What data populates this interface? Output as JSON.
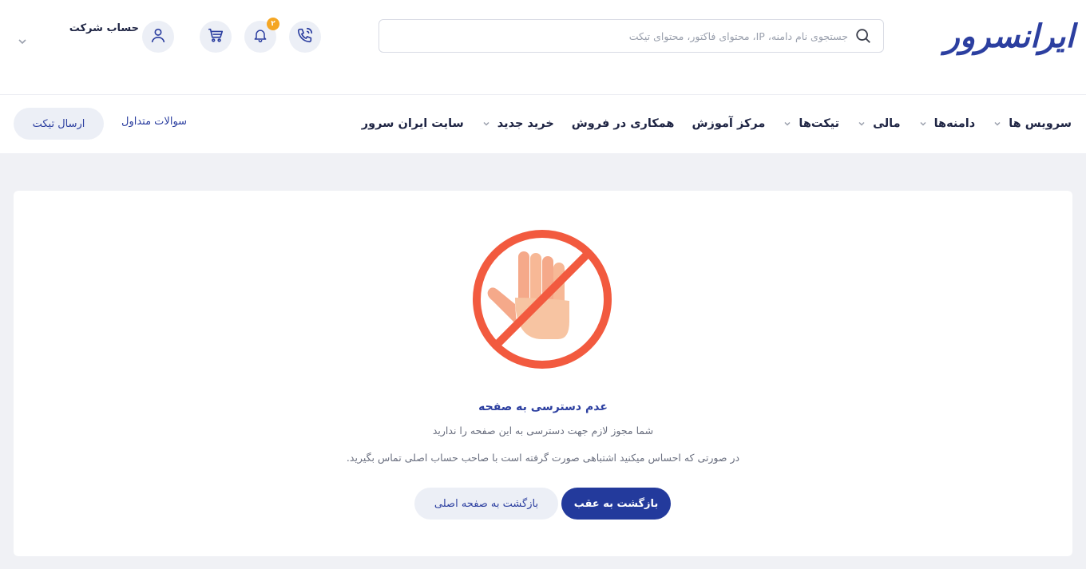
{
  "brand": {
    "logo_text": "ایرانسرور",
    "accent": "#2c3fa0",
    "primary_button": "#233a9c"
  },
  "header": {
    "search_placeholder": "جستجوی نام دامنه، IP، محتوای فاکتور، محتوای تیکت",
    "icons": [
      "phone-icon",
      "bell-icon",
      "cart-icon",
      "user-icon"
    ],
    "notification_count": "۲",
    "account_label": "حساب شرکت"
  },
  "nav": {
    "items": [
      {
        "label": "سرویس ها",
        "has_dropdown": true
      },
      {
        "label": "دامنه‌ها",
        "has_dropdown": true
      },
      {
        "label": "مالی",
        "has_dropdown": true
      },
      {
        "label": "تیکت‌ها",
        "has_dropdown": true
      },
      {
        "label": "مرکز آموزش",
        "has_dropdown": false
      },
      {
        "label": "همکاری در فروش",
        "has_dropdown": false
      },
      {
        "label": "خرید جدید",
        "has_dropdown": true
      },
      {
        "label": "سایت ایران سرور",
        "has_dropdown": false
      }
    ],
    "faq_label": "سوالات متداول",
    "send_ticket_label": "ارسال تیکت"
  },
  "error": {
    "title": "عدم دسترسی به صفحه",
    "message": "شما مجوز لازم جهت دسترسی به این صفحه را ندارید",
    "hint": "در صورتی که احساس میکنید اشتباهی صورت گرفته است با صاحب حساب اصلی تماس بگیرید.",
    "back_button": "بازگشت به عقب",
    "home_button": "بازگشت به صفحه اصلی"
  }
}
